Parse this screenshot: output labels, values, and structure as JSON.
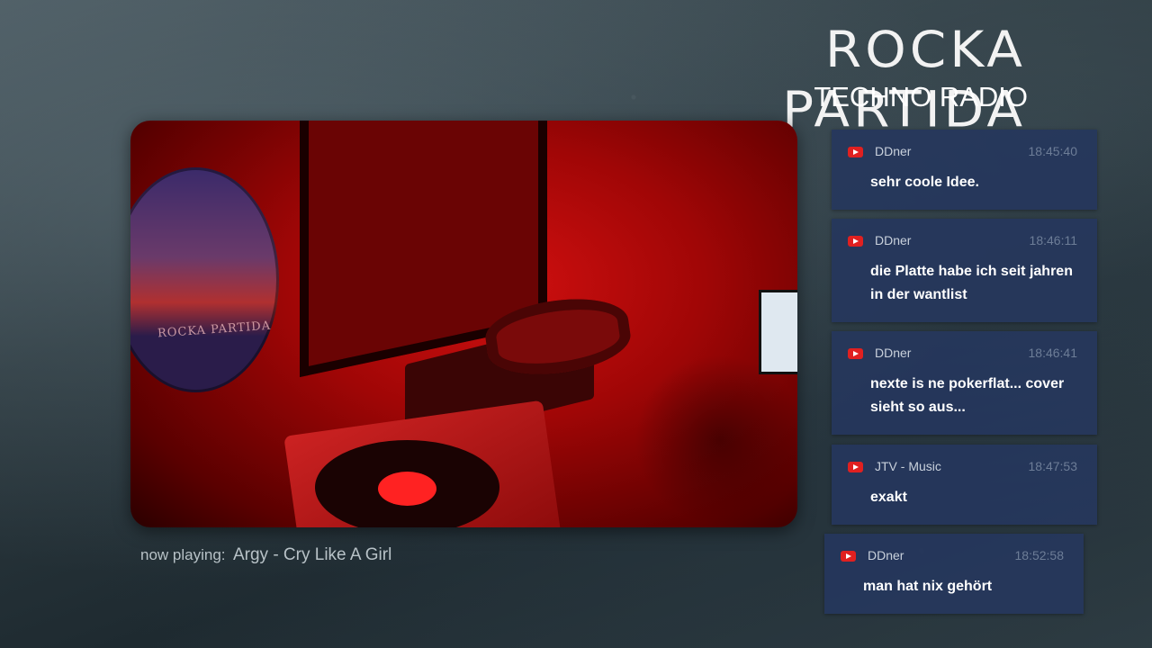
{
  "brand": {
    "title": "ROCKA PARTIDA",
    "subtitle": "TECHNO RADIO"
  },
  "video": {
    "poster_text": "ROCKA PARTIDA"
  },
  "now_playing": {
    "label": "now playing:",
    "track": "Argy - Cry Like A Girl"
  },
  "chat": {
    "icon": "youtube-icon",
    "messages": [
      {
        "author": "DDner",
        "time": "18:45:40",
        "text": "sehr coole Idee."
      },
      {
        "author": "DDner",
        "time": "18:46:11",
        "text": "die Platte habe ich seit jahren in der wantlist"
      },
      {
        "author": "DDner",
        "time": "18:46:41",
        "text": "nexte is ne pokerflat... cover sieht so aus..."
      },
      {
        "author": "JTV - Music",
        "time": "18:47:53",
        "text": "exakt"
      },
      {
        "author": "DDner",
        "time": "18:52:58",
        "text": "man hat nix gehört"
      }
    ]
  },
  "colors": {
    "chat_background": "#26375c",
    "youtube_red": "#e02020",
    "video_red": "#d21010"
  }
}
